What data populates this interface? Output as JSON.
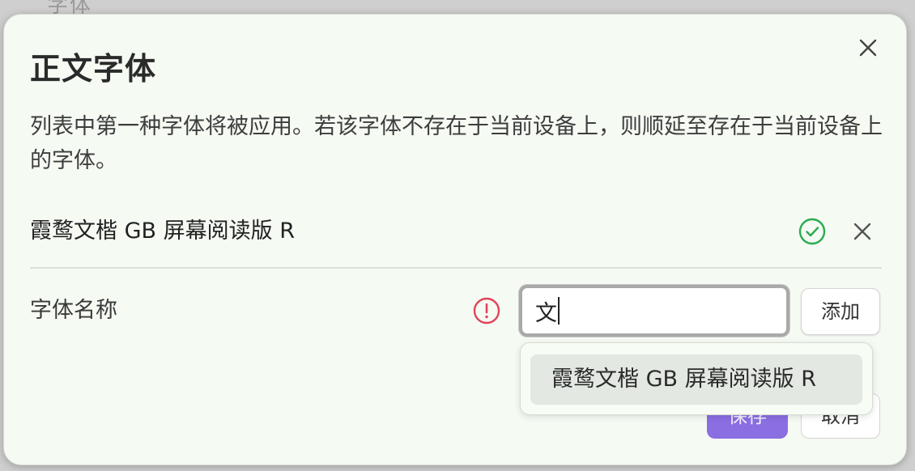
{
  "background": {
    "partial_heading": "字体"
  },
  "dialog": {
    "title": "正文字体",
    "description": "列表中第一种字体将被应用。若该字体不存在于当前设备上，则顺延至存在于当前设备上的字体。",
    "font_list": [
      {
        "name": "霞鹜文楷 GB 屏幕阅读版 R",
        "status_icon": "check-circle-icon",
        "status_color": "#2bab4f"
      }
    ],
    "field": {
      "label": "字体名称",
      "warning_icon": "alert-circle-icon",
      "warning_color": "#e0445a",
      "input_value": "文",
      "add_label": "添加"
    },
    "suggestions": [
      {
        "label": "霞鹜文楷 GB 屏幕阅读版 R"
      }
    ],
    "save_label": "保存",
    "cancel_label": "取消"
  },
  "colors": {
    "accent": "#8a6ee2",
    "dialog_bg": "#f5faf3"
  }
}
